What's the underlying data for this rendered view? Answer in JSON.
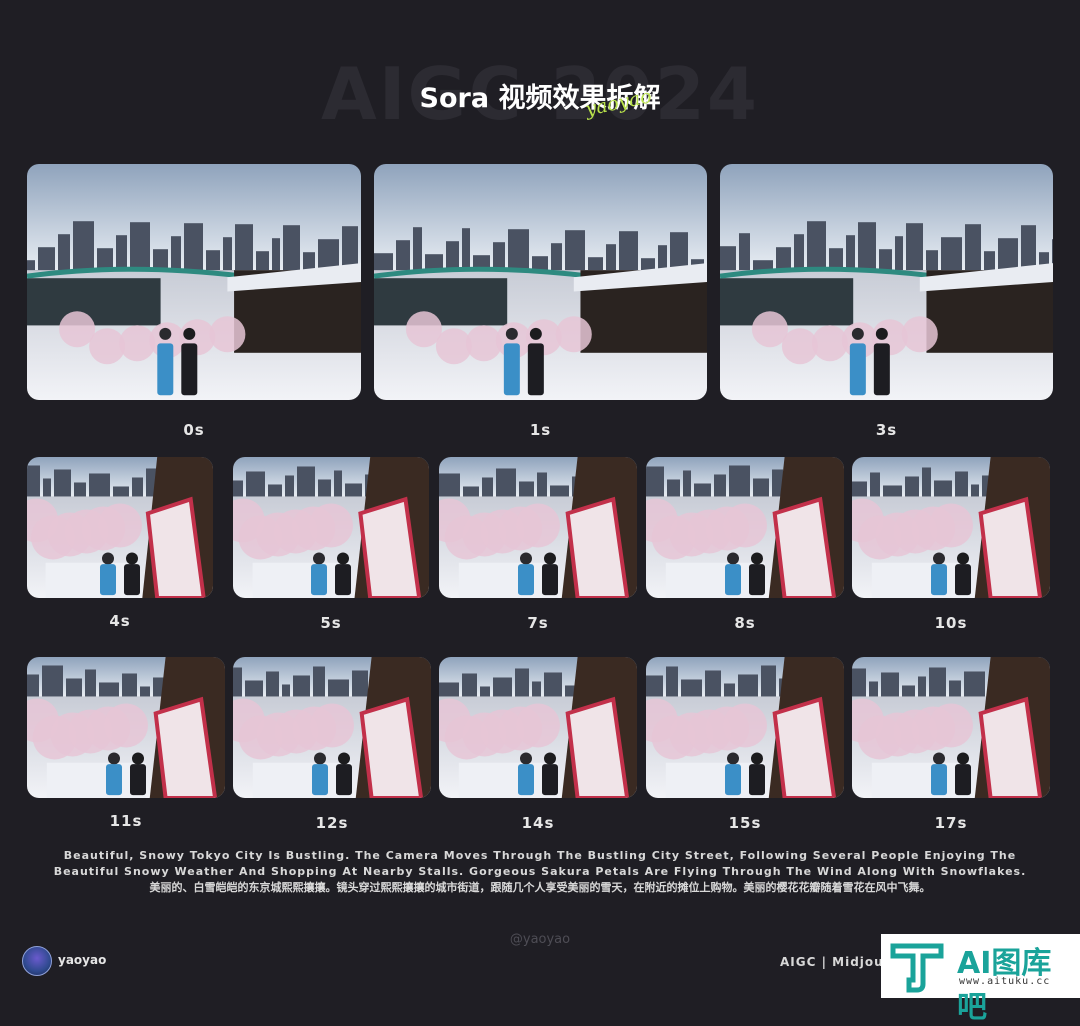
{
  "header": {
    "bg_text": "AIGC 2024",
    "title": "Sora 视频效果拆解",
    "script": "yaoyao"
  },
  "frames": [
    {
      "time": "0s"
    },
    {
      "time": "1s"
    },
    {
      "time": "3s"
    },
    {
      "time": "4s"
    },
    {
      "time": "5s"
    },
    {
      "time": "7s"
    },
    {
      "time": "8s"
    },
    {
      "time": "10s"
    },
    {
      "time": "11s"
    },
    {
      "time": "12s"
    },
    {
      "time": "14s"
    },
    {
      "time": "15s"
    },
    {
      "time": "17s"
    }
  ],
  "caption": {
    "en_line1": "Beautiful, Snowy Tokyo City Is Bustling. The Camera Moves Through The Bustling City Street, Following Several People Enjoying The",
    "en_line2": "Beautiful Snowy Weather And Shopping At Nearby Stalls. Gorgeous Sakura Petals Are Flying Through The Wind Along With Snowflakes.",
    "zh": "美丽的、白雪皑皑的东京城熙熙攘攘。镜头穿过熙熙攘攘的城市街道，跟随几个人享受美丽的雪天，在附近的摊位上购物。美丽的樱花花瓣随着雪花在风中飞舞。"
  },
  "watermark": "@yaoyao",
  "author": {
    "name": "yaoyao"
  },
  "footer": {
    "text": "AIGC | Midjourn"
  },
  "brand": {
    "name": "AI图库吧",
    "url": "www.aituku.cc"
  },
  "colors": {
    "background": "#1f1e24",
    "brand_teal": "#1aa39a",
    "accent_green": "#b9e24a"
  }
}
